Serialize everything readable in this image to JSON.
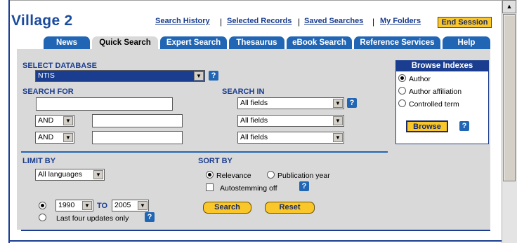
{
  "logo": "Village 2",
  "top_links": {
    "search_history": "Search History",
    "selected_records": "Selected Records",
    "saved_searches": "Saved Searches",
    "my_folders": "My Folders",
    "separator": "|",
    "end_session": "End Session"
  },
  "tabs": [
    {
      "label": "News",
      "active": false
    },
    {
      "label": "Quick Search",
      "active": true
    },
    {
      "label": "Expert Search",
      "active": false
    },
    {
      "label": "Thesaurus",
      "active": false
    },
    {
      "label": "eBook Search",
      "active": false
    },
    {
      "label": "Reference Services",
      "active": false
    },
    {
      "label": "Help",
      "active": false
    }
  ],
  "select_database": {
    "label": "SELECT DATABASE",
    "value": "NTIS"
  },
  "search_for": {
    "label": "SEARCH FOR",
    "rows": [
      {
        "operator": "",
        "value": ""
      },
      {
        "operator": "AND",
        "value": ""
      },
      {
        "operator": "AND",
        "value": ""
      }
    ]
  },
  "search_in": {
    "label": "SEARCH IN",
    "fields": [
      "All fields",
      "All fields",
      "All fields"
    ]
  },
  "browse_indexes": {
    "title": "Browse Indexes",
    "options": [
      {
        "label": "Author",
        "selected": true
      },
      {
        "label": "Author affiliation",
        "selected": false
      },
      {
        "label": "Controlled term",
        "selected": false
      }
    ],
    "browse_button": "Browse"
  },
  "limit_by": {
    "label": "LIMIT BY",
    "language": "All languages",
    "year_from": "1990",
    "to_label": "TO",
    "year_to": "2005",
    "last_four_label": "Last four updates only",
    "year_range_selected": true
  },
  "sort_by": {
    "label": "SORT BY",
    "relevance": "Relevance",
    "publication_year": "Publication year",
    "relevance_selected": true,
    "autostemming": "Autostemming off",
    "autostemming_checked": false
  },
  "actions": {
    "search": "Search",
    "reset": "Reset"
  },
  "help_glyph": "?",
  "colors": {
    "brand_blue": "#1a3d8f",
    "tab_blue": "#2166b5",
    "panel_gray": "#d9d9d9",
    "gold": "#f9c72a"
  }
}
